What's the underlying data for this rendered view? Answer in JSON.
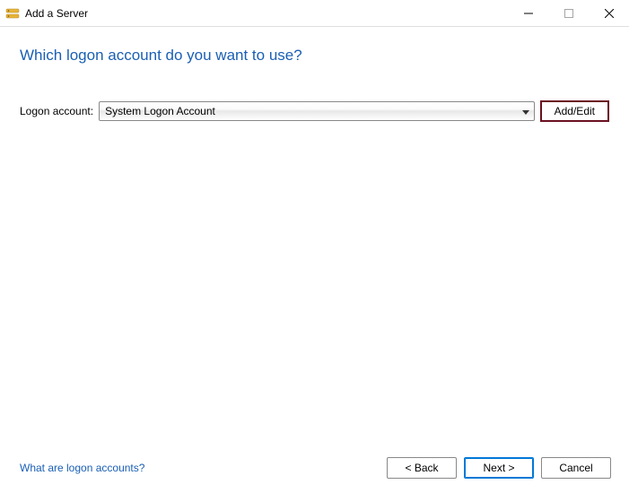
{
  "window": {
    "title": "Add a Server",
    "icon": "server-icon"
  },
  "heading": "Which logon account do you want to use?",
  "form": {
    "label": "Logon account:",
    "selected": "System Logon Account",
    "add_edit_label": "Add/Edit"
  },
  "footer": {
    "help_link": "What are logon accounts?",
    "back_label": "< Back",
    "next_label": "Next >",
    "cancel_label": "Cancel"
  }
}
